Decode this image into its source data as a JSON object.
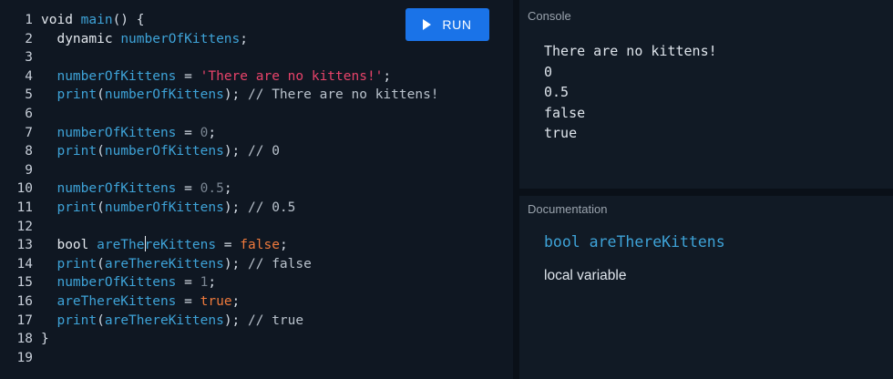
{
  "toolbar": {
    "run_label": "RUN",
    "run_icon": "play-icon"
  },
  "editor": {
    "lines": [
      {
        "no": "1",
        "tokens": [
          {
            "t": "void ",
            "c": "kw"
          },
          {
            "t": "main",
            "c": "fn"
          },
          {
            "t": "() {",
            "c": "punc"
          }
        ]
      },
      {
        "no": "2",
        "tokens": [
          {
            "t": "  dynamic ",
            "c": "kw"
          },
          {
            "t": "numberOfKittens",
            "c": "var"
          },
          {
            "t": ";",
            "c": "punc"
          }
        ]
      },
      {
        "no": "3",
        "tokens": []
      },
      {
        "no": "4",
        "tokens": [
          {
            "t": "  ",
            "c": "punc"
          },
          {
            "t": "numberOfKittens",
            "c": "var"
          },
          {
            "t": " = ",
            "c": "punc"
          },
          {
            "t": "'There are no kittens!'",
            "c": "str"
          },
          {
            "t": ";",
            "c": "punc"
          }
        ]
      },
      {
        "no": "5",
        "tokens": [
          {
            "t": "  ",
            "c": "punc"
          },
          {
            "t": "print",
            "c": "fn"
          },
          {
            "t": "(",
            "c": "punc"
          },
          {
            "t": "numberOfKittens",
            "c": "var"
          },
          {
            "t": "); ",
            "c": "punc"
          },
          {
            "t": "// There are no kittens!",
            "c": "cmt"
          }
        ]
      },
      {
        "no": "6",
        "tokens": []
      },
      {
        "no": "7",
        "tokens": [
          {
            "t": "  ",
            "c": "punc"
          },
          {
            "t": "numberOfKittens",
            "c": "var"
          },
          {
            "t": " = ",
            "c": "punc"
          },
          {
            "t": "0",
            "c": "num"
          },
          {
            "t": ";",
            "c": "punc"
          }
        ]
      },
      {
        "no": "8",
        "tokens": [
          {
            "t": "  ",
            "c": "punc"
          },
          {
            "t": "print",
            "c": "fn"
          },
          {
            "t": "(",
            "c": "punc"
          },
          {
            "t": "numberOfKittens",
            "c": "var"
          },
          {
            "t": "); ",
            "c": "punc"
          },
          {
            "t": "// 0",
            "c": "cmt"
          }
        ]
      },
      {
        "no": "9",
        "tokens": []
      },
      {
        "no": "10",
        "tokens": [
          {
            "t": "  ",
            "c": "punc"
          },
          {
            "t": "numberOfKittens",
            "c": "var"
          },
          {
            "t": " = ",
            "c": "punc"
          },
          {
            "t": "0.5",
            "c": "num"
          },
          {
            "t": ";",
            "c": "punc"
          }
        ]
      },
      {
        "no": "11",
        "tokens": [
          {
            "t": "  ",
            "c": "punc"
          },
          {
            "t": "print",
            "c": "fn"
          },
          {
            "t": "(",
            "c": "punc"
          },
          {
            "t": "numberOfKittens",
            "c": "var"
          },
          {
            "t": "); ",
            "c": "punc"
          },
          {
            "t": "// 0.5",
            "c": "cmt"
          }
        ]
      },
      {
        "no": "12",
        "tokens": []
      },
      {
        "no": "13",
        "tokens": [
          {
            "t": "  bool ",
            "c": "kw"
          },
          {
            "t": "areThe",
            "c": "var"
          },
          {
            "t": "|",
            "c": "cursor"
          },
          {
            "t": "reKittens",
            "c": "var"
          },
          {
            "t": " = ",
            "c": "punc"
          },
          {
            "t": "false",
            "c": "bool"
          },
          {
            "t": ";",
            "c": "punc"
          }
        ]
      },
      {
        "no": "14",
        "tokens": [
          {
            "t": "  ",
            "c": "punc"
          },
          {
            "t": "print",
            "c": "fn"
          },
          {
            "t": "(",
            "c": "punc"
          },
          {
            "t": "areThereKittens",
            "c": "var"
          },
          {
            "t": "); ",
            "c": "punc"
          },
          {
            "t": "// false",
            "c": "cmt"
          }
        ]
      },
      {
        "no": "15",
        "tokens": [
          {
            "t": "  ",
            "c": "punc"
          },
          {
            "t": "numberOfKittens",
            "c": "var"
          },
          {
            "t": " = ",
            "c": "punc"
          },
          {
            "t": "1",
            "c": "num"
          },
          {
            "t": ";",
            "c": "punc"
          }
        ]
      },
      {
        "no": "16",
        "tokens": [
          {
            "t": "  ",
            "c": "punc"
          },
          {
            "t": "areThereKittens",
            "c": "var"
          },
          {
            "t": " = ",
            "c": "punc"
          },
          {
            "t": "true",
            "c": "bool"
          },
          {
            "t": ";",
            "c": "punc"
          }
        ]
      },
      {
        "no": "17",
        "tokens": [
          {
            "t": "  ",
            "c": "punc"
          },
          {
            "t": "print",
            "c": "fn"
          },
          {
            "t": "(",
            "c": "punc"
          },
          {
            "t": "areThereKittens",
            "c": "var"
          },
          {
            "t": "); ",
            "c": "punc"
          },
          {
            "t": "// true",
            "c": "cmt"
          }
        ]
      },
      {
        "no": "18",
        "tokens": [
          {
            "t": "}",
            "c": "punc"
          }
        ]
      },
      {
        "no": "19",
        "tokens": []
      }
    ]
  },
  "console": {
    "title": "Console",
    "lines": [
      "There are no kittens!",
      "0",
      "0.5",
      "false",
      "true"
    ]
  },
  "documentation": {
    "title": "Documentation",
    "signature": "bool areThereKittens",
    "kind": "local variable"
  },
  "colors": {
    "run_button": "#1a73e8",
    "identifier": "#3ea3d8",
    "string": "#e8436a",
    "boolean": "#f07a3c"
  }
}
